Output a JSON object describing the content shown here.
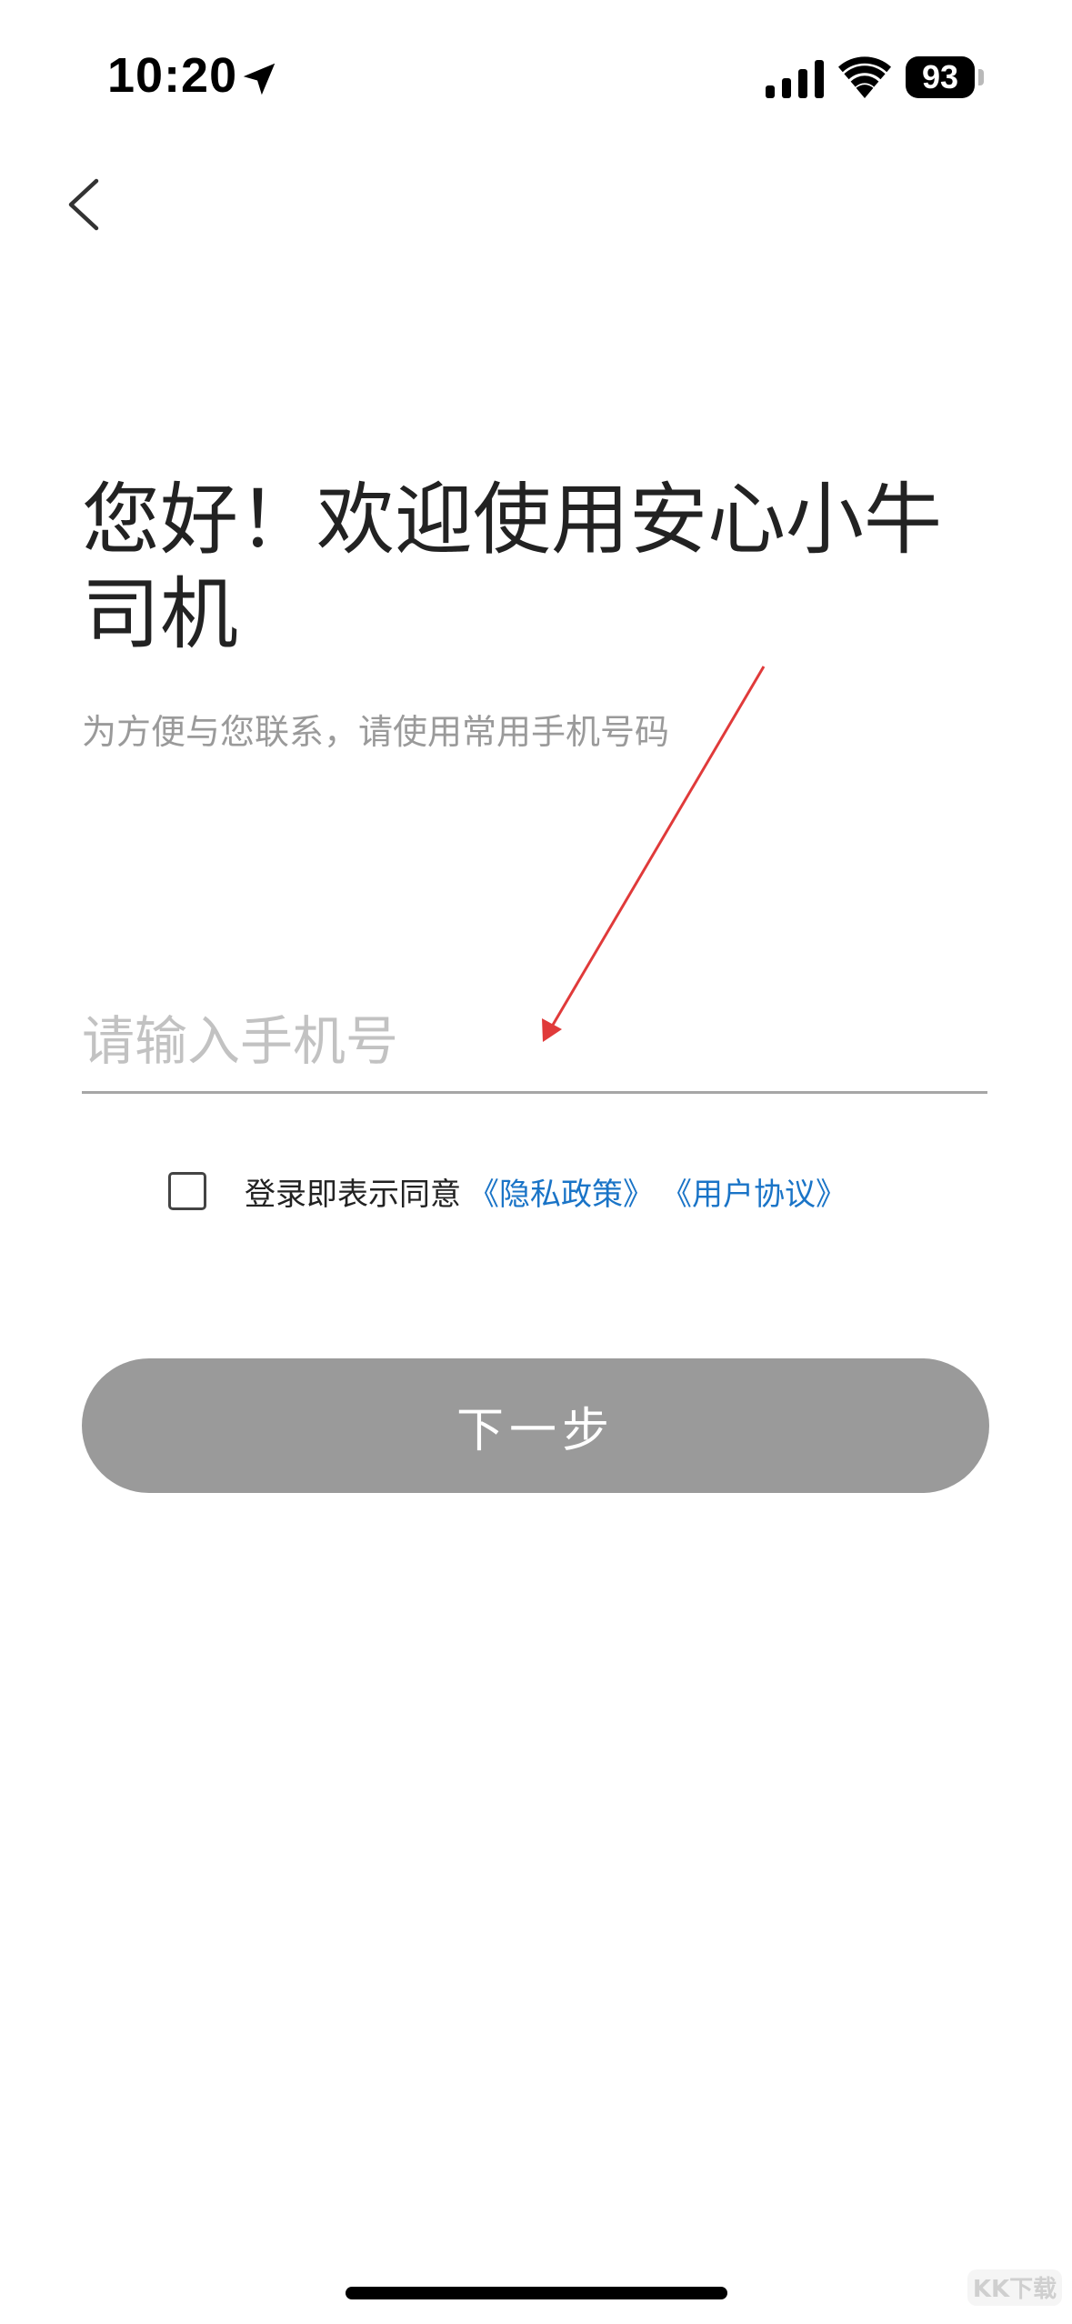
{
  "status_bar": {
    "time": "10:20",
    "battery": "93"
  },
  "nav": {
    "back_icon": "chevron-left-icon"
  },
  "welcome": {
    "title": "您好！欢迎使用安心小牛司机",
    "subtitle": "为方便与您联系，请使用常用手机号码"
  },
  "phone": {
    "placeholder": "请输入手机号",
    "value": ""
  },
  "agreement": {
    "checked": false,
    "text": "登录即表示同意",
    "privacy_link": "《隐私政策》",
    "user_link": "《用户协议》",
    "link_color": "#1a74c7"
  },
  "next_button": {
    "label": "下一步",
    "color": "#9a9a9a",
    "enabled": false
  },
  "annotation": {
    "color": "#e03a3a"
  },
  "watermark": {
    "text": "KK下载"
  }
}
